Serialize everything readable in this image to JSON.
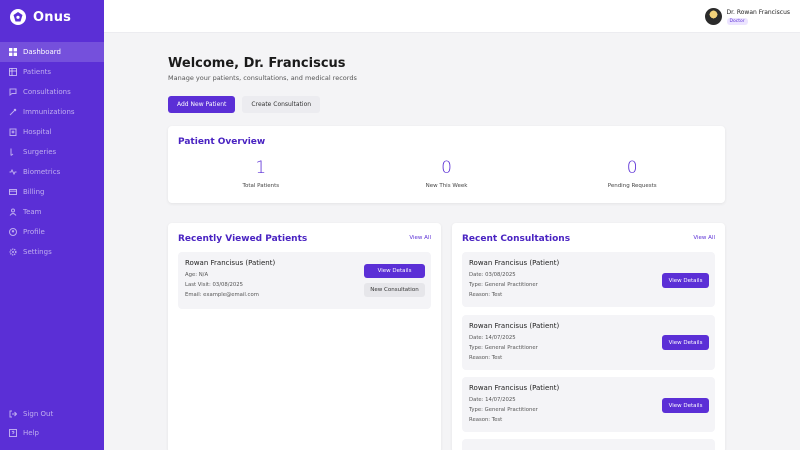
{
  "brand": {
    "name": "Onus"
  },
  "sidebar": {
    "items": [
      {
        "label": "Dashboard",
        "icon": "dashboard-icon"
      },
      {
        "label": "Patients",
        "icon": "patients-icon"
      },
      {
        "label": "Consultations",
        "icon": "consultations-icon"
      },
      {
        "label": "Immunizations",
        "icon": "syringe-icon"
      },
      {
        "label": "Hospital",
        "icon": "hospital-icon"
      },
      {
        "label": "Surgeries",
        "icon": "scalpel-icon"
      },
      {
        "label": "Biometrics",
        "icon": "biometrics-icon"
      },
      {
        "label": "Billing",
        "icon": "billing-icon"
      },
      {
        "label": "Team",
        "icon": "team-icon"
      },
      {
        "label": "Profile",
        "icon": "profile-icon"
      },
      {
        "label": "Settings",
        "icon": "settings-icon"
      }
    ],
    "bottom": [
      {
        "label": "Sign Out",
        "icon": "sign-out-icon"
      },
      {
        "label": "Help",
        "icon": "help-icon"
      }
    ]
  },
  "header": {
    "user_name": "Dr. Rowan Franciscus",
    "user_role": "Doctor"
  },
  "main": {
    "welcome": "Welcome, Dr. Franciscus",
    "subtitle": "Manage your patients, consultations, and medical records",
    "add_patient_label": "Add New Patient",
    "create_consultation_label": "Create Consultation"
  },
  "overview": {
    "title": "Patient Overview",
    "stats": [
      {
        "value": "1",
        "label": "Total Patients"
      },
      {
        "value": "0",
        "label": "New This Week"
      },
      {
        "value": "0",
        "label": "Pending Requests"
      }
    ]
  },
  "recent_patients": {
    "title": "Recently Viewed Patients",
    "view_all": "View All",
    "items": [
      {
        "name": "Rowan Francisus (Patient)",
        "age": "Age: N/A",
        "last_visit": "Last Visit: 03/08/2025",
        "email": "Email: example@email.com",
        "view_label": "View Details",
        "consult_label": "New Consultation"
      }
    ]
  },
  "recent_consultations": {
    "title": "Recent Consultations",
    "view_all": "View All",
    "items": [
      {
        "name": "Rowan Francisus (Patient)",
        "date": "Date: 03/08/2025",
        "type": "Type: General Practitioner",
        "reason": "Reason: Test",
        "view_label": "View Details"
      },
      {
        "name": "Rowan Francisus (Patient)",
        "date": "Date: 14/07/2025",
        "type": "Type: General Practitioner",
        "reason": "Reason: Test",
        "view_label": "View Details"
      },
      {
        "name": "Rowan Francisus (Patient)",
        "date": "Date: 14/07/2025",
        "type": "Type: General Practitioner",
        "reason": "Reason: Test",
        "view_label": "View Details"
      }
    ]
  },
  "colors": {
    "accent": "#5b2fd6",
    "sidebar": "#5b2fd6",
    "background": "#f4f4f6"
  }
}
